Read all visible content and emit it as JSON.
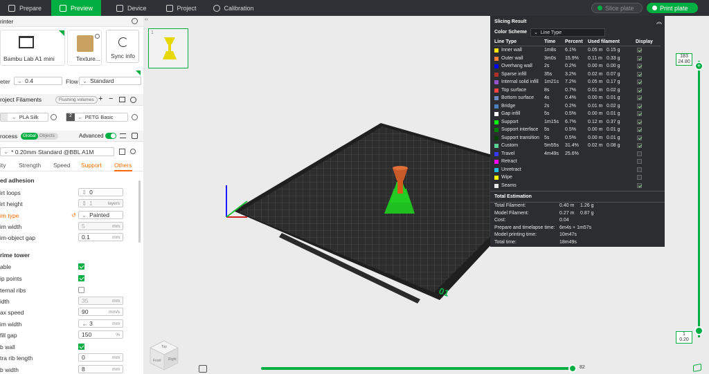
{
  "tabs": [
    {
      "label": "Prepare",
      "icon": "home-icon"
    },
    {
      "label": "Preview",
      "icon": "cube-icon"
    },
    {
      "label": "Device",
      "icon": "device-icon"
    },
    {
      "label": "Project",
      "icon": "project-icon"
    },
    {
      "label": "Calibration",
      "icon": "calibration-icon"
    }
  ],
  "toolbar": {
    "slice_label": "Slice plate",
    "print_label": "Print plate"
  },
  "printer": {
    "header": "rinter",
    "name": "Bambu Lab A1 mini",
    "plate": "Texture...",
    "sync": "Sync info",
    "nozzle_label": "eter",
    "nozzle_value": "0.4",
    "flow_label": "Flow",
    "flow_value": "Standard"
  },
  "filaments": {
    "header": "roject Filaments",
    "badge": "Flushing volumes",
    "items": [
      {
        "num": "1",
        "name": "PLA Silk",
        "color": "#e8e8e8"
      },
      {
        "num": "2",
        "name": "PETG Basic",
        "color": "#2e2e2e"
      }
    ]
  },
  "process": {
    "header": "rocess",
    "global": "Global",
    "objects": "Objects",
    "advanced": "Advanced",
    "preset": "* 0.20mm Standard @BBL A1M",
    "tabs": [
      "ity",
      "Strength",
      "Speed",
      "Support",
      "Others"
    ]
  },
  "bed_adhesion": {
    "title": "ed adhesion",
    "rows": [
      {
        "label": "irt loops",
        "value": "0",
        "unit": ""
      },
      {
        "label": "irt height",
        "value": "1",
        "unit": "layers"
      },
      {
        "label": "im type",
        "value": "Painted",
        "unit": ""
      },
      {
        "label": "im width",
        "value": "5",
        "unit": "mm"
      },
      {
        "label": "im-object gap",
        "value": "0.1",
        "unit": "mm"
      }
    ]
  },
  "prime_tower": {
    "title": "rime tower",
    "rows": [
      {
        "label": "able"
      },
      {
        "label": "ip points"
      },
      {
        "label": "ternal ribs"
      },
      {
        "label": "idth",
        "value": "35",
        "unit": "mm"
      },
      {
        "label": "ax speed",
        "value": "90",
        "unit": "mm/s"
      },
      {
        "label": "im width",
        "value": "3",
        "unit": "mm"
      },
      {
        "label": "fill gap",
        "value": "150",
        "unit": "%"
      },
      {
        "label": "b wall"
      },
      {
        "label": "tra rib length",
        "value": "0",
        "unit": "mm"
      },
      {
        "label": "b width",
        "value": "8",
        "unit": "mm"
      }
    ]
  },
  "plate_number": "01",
  "thumb_number": "1",
  "layer_slider": {
    "top_layer": "183",
    "top_height": "24.80",
    "bottom_layer": "1",
    "bottom_height": "0.20"
  },
  "move_slider_value": "82",
  "cube_faces": {
    "top": "Top",
    "front": "Front",
    "right": "Right"
  },
  "slicing_result": {
    "title": "Slicing Result",
    "color_scheme_label": "Color Scheme",
    "color_scheme_value": "Line Type",
    "headers": [
      "Line Type",
      "Time",
      "Percent",
      "Used filament",
      "Display"
    ],
    "rows": [
      {
        "name": "Inner wall",
        "color": "#ffe600",
        "time": "1m8s",
        "pct": "6.1%",
        "m": "0.05 m",
        "g": "0.15 g",
        "on": true
      },
      {
        "name": "Outer wall",
        "color": "#ff7d38",
        "time": "3m0s",
        "pct": "15.9%",
        "m": "0.11 m",
        "g": "0.33 g",
        "on": true
      },
      {
        "name": "Overhang wall",
        "color": "#0000ff",
        "time": "2s",
        "pct": "0.2%",
        "m": "0.00 m",
        "g": "0.00 g",
        "on": true
      },
      {
        "name": "Sparse infill",
        "color": "#b03029",
        "time": "35s",
        "pct": "3.2%",
        "m": "0.02 m",
        "g": "0.07 g",
        "on": true
      },
      {
        "name": "Internal solid infill",
        "color": "#9654cc",
        "time": "1m21s",
        "pct": "7.2%",
        "m": "0.05 m",
        "g": "0.17 g",
        "on": true
      },
      {
        "name": "Top surface",
        "color": "#ff4040",
        "time": "8s",
        "pct": "0.7%",
        "m": "0.01 m",
        "g": "0.02 g",
        "on": true
      },
      {
        "name": "Bottom surface",
        "color": "#6e8bc4",
        "time": "4s",
        "pct": "0.4%",
        "m": "0.00 m",
        "g": "0.01 g",
        "on": true
      },
      {
        "name": "Bridge",
        "color": "#4d80ba",
        "time": "2s",
        "pct": "0.2%",
        "m": "0.01 m",
        "g": "0.02 g",
        "on": true
      },
      {
        "name": "Gap infill",
        "color": "#ffffff",
        "time": "5s",
        "pct": "0.5%",
        "m": "0.00 m",
        "g": "0.01 g",
        "on": true
      },
      {
        "name": "Support",
        "color": "#00ff00",
        "time": "1m15s",
        "pct": "6.7%",
        "m": "0.12 m",
        "g": "0.37 g",
        "on": true
      },
      {
        "name": "Support interface",
        "color": "#008000",
        "time": "5s",
        "pct": "0.5%",
        "m": "0.00 m",
        "g": "0.01 g",
        "on": true
      },
      {
        "name": "Support transition",
        "color": "#004000",
        "time": "5s",
        "pct": "0.5%",
        "m": "0.00 m",
        "g": "0.01 g",
        "on": true
      },
      {
        "name": "Custom",
        "color": "#5ed194",
        "time": "5m55s",
        "pct": "31.4%",
        "m": "0.02 m",
        "g": "0.08 g",
        "on": true
      },
      {
        "name": "Travel",
        "color": "#3838ff",
        "time": "4m49s",
        "pct": "25.6%",
        "m": "",
        "g": "",
        "on": false
      },
      {
        "name": "Retract",
        "color": "#ff00ff",
        "time": "",
        "pct": "",
        "m": "",
        "g": "",
        "on": false
      },
      {
        "name": "Unretract",
        "color": "#27c0e0",
        "time": "",
        "pct": "",
        "m": "",
        "g": "",
        "on": false
      },
      {
        "name": "Wipe",
        "color": "#ffff00",
        "time": "",
        "pct": "",
        "m": "",
        "g": "",
        "on": false
      },
      {
        "name": "Seams",
        "color": "#e8e8e8",
        "time": "",
        "pct": "",
        "m": "",
        "g": "",
        "on": true
      }
    ],
    "total_title": "Total Estimation",
    "totals": [
      {
        "label": "Total Filament:",
        "v1": "0.40 m",
        "v2": "1.26 g"
      },
      {
        "label": "Model Filament:",
        "v1": "0.27 m",
        "v2": "0.87 g"
      },
      {
        "label": "Cost:",
        "v1": "0.04",
        "v2": ""
      },
      {
        "label": "Prepare and timelapse time:",
        "v1": "6m4s + 1m57s",
        "v2": ""
      },
      {
        "label": "Model printing time:",
        "v1": "10m47s",
        "v2": ""
      },
      {
        "label": "Total time:",
        "v1": "18m49s",
        "v2": ""
      }
    ]
  }
}
